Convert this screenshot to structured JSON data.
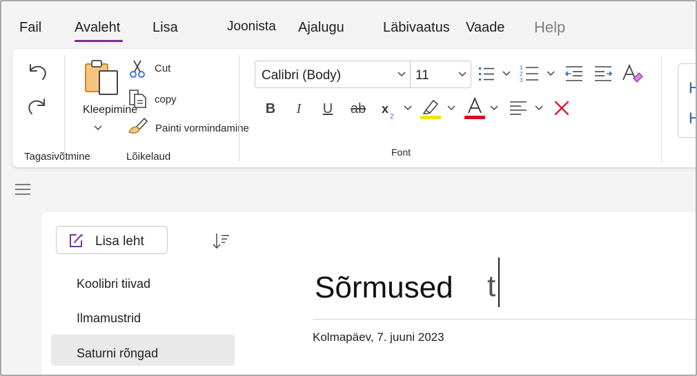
{
  "menu": {
    "tabs": [
      {
        "label": "Fail"
      },
      {
        "label": "Avaleht",
        "active": true
      },
      {
        "label": "Lisa"
      },
      {
        "label": "Joonista"
      },
      {
        "label": "Ajalugu"
      },
      {
        "label": "Läbivaatus"
      },
      {
        "label": "Vaade"
      },
      {
        "label": "Help",
        "disabled": true
      }
    ]
  },
  "ribbon": {
    "undo_group": {
      "label": "Tagasivõtmine",
      "icons": [
        "undo-icon",
        "redo-icon"
      ]
    },
    "clipboard": {
      "label": "Lõikelaud",
      "paste_label": "Kleepimine",
      "cut_label": "Cut",
      "copy_label": "copy",
      "format_painter_label": "Painti vormindamine"
    },
    "font": {
      "label": "Font",
      "font_name": "Calibri (Body)",
      "font_size": "11",
      "highlight_color": "#f2e600",
      "font_color": "#e0001b",
      "clear_color": "#e0001b"
    },
    "right_card": [
      "H",
      "H"
    ]
  },
  "accent_color": "#7a2c9e",
  "sidebar": {
    "add_page_label": "Lisa leht",
    "pages": [
      {
        "title": "Koolibri tiivad"
      },
      {
        "title": "Ilmamustrid"
      },
      {
        "title": "Saturni rõngad",
        "selected": true
      }
    ]
  },
  "page": {
    "title": "Sõrmused",
    "typed_text": "t",
    "date": "Kolmapäev, 7. juuni 2023"
  }
}
